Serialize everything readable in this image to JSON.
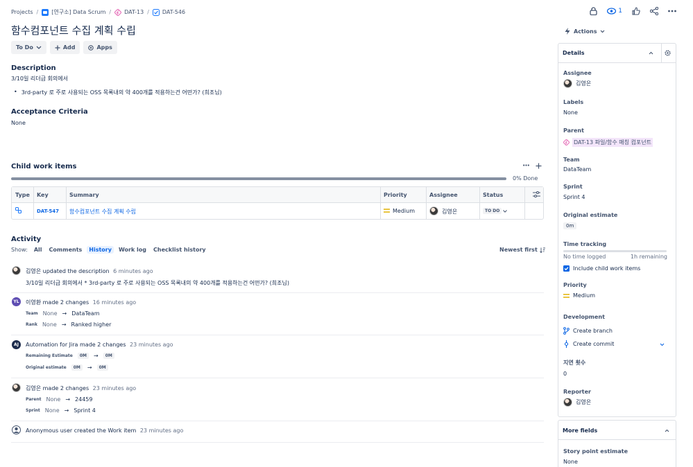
{
  "breadcrumb": {
    "projects": "Projects",
    "project": "[연구소] Data Scrum",
    "parent": "DAT-13",
    "current": "DAT-546"
  },
  "top": {
    "watch_count": "1"
  },
  "issue": {
    "title": "함수컴포넌트 수집 계획 수립",
    "status_button": "To Do",
    "add_button": "Add",
    "apps_button": "Apps"
  },
  "description": {
    "heading": "Description",
    "line1": "3/10일 리더급 회의에서",
    "bullet1": "3rd-party 로 주로 사용되는 OSS 목록내의 약 400개를 적용하는건 어떤가? (희조님)"
  },
  "acceptance": {
    "heading": "Acceptance Criteria",
    "value": "None"
  },
  "child": {
    "heading": "Child work items",
    "progress_text": "0% Done",
    "columns": [
      "Type",
      "Key",
      "Summary",
      "Priority",
      "Assignee",
      "Status"
    ],
    "rows": [
      {
        "key": "DAT-547",
        "summary": "함수컴포넌트 수집 계획 수립",
        "priority": "Medium",
        "assignee": "김영은",
        "status": "TO DO"
      }
    ]
  },
  "activity": {
    "heading": "Activity",
    "show_label": "Show:",
    "tabs": [
      "All",
      "Comments",
      "History",
      "Work log",
      "Checklist history"
    ],
    "active_tab": "History",
    "sort": "Newest first",
    "entries": [
      {
        "actor": "김영은",
        "verb": "updated the",
        "object": "description",
        "time": "6 minutes ago",
        "detail": "3/10일 리더급 회의에서 * 3rd-party 로 주로 사용되는 OSS 목록내의 약 400개를 적용하는건 어떤가? (희조님)"
      },
      {
        "actor": "이영환",
        "verb": "made 2 changes",
        "time": "16 minutes ago",
        "changes": [
          {
            "field": "Team",
            "from": "None",
            "to": "DataTeam"
          },
          {
            "field": "Rank",
            "from": "None",
            "to": "Ranked higher"
          }
        ]
      },
      {
        "actor": "Automation for Jira",
        "verb": "made 2 changes",
        "time": "23 minutes ago",
        "changes": [
          {
            "field": "Remaining Estimate",
            "from": "0M",
            "to": "0M"
          },
          {
            "field": "Original estimate",
            "from": "0M",
            "to": "0M"
          }
        ]
      },
      {
        "actor": "김영은",
        "verb": "made 2 changes",
        "time": "23 minutes ago",
        "changes": [
          {
            "field": "Parent",
            "from": "None",
            "to": "24459"
          },
          {
            "field": "Sprint",
            "from": "None",
            "to": "Sprint 4"
          }
        ]
      },
      {
        "actor": "Anonymous user",
        "verb": "created the",
        "object": "Work item",
        "time": "23 minutes ago"
      }
    ]
  },
  "sidebar": {
    "actions": "Actions",
    "details": "Details",
    "assignee_label": "Assignee",
    "assignee": "김영은",
    "labels_label": "Labels",
    "labels": "None",
    "parent_label": "Parent",
    "parent": "DAT-13 파일/함수 매칭 컴포넌트",
    "team_label": "Team",
    "team": "DataTeam",
    "sprint_label": "Sprint",
    "sprint": "Sprint 4",
    "orig_label": "Original estimate",
    "orig": "0m",
    "tt_label": "Time tracking",
    "tt_logged": "No time logged",
    "tt_remaining": "1h remaining",
    "include_child": "Include child work items",
    "priority_label": "Priority",
    "priority": "Medium",
    "dev_label": "Development",
    "create_branch": "Create branch",
    "create_commit": "Create commit",
    "delay_label": "지연 횟수",
    "delay": "0",
    "reporter_label": "Reporter",
    "reporter": "김영은",
    "more_fields": "More fields",
    "spe_label": "Story point estimate",
    "spe": "None"
  },
  "colors": {
    "accent": "#0c66e4",
    "epic": "#e774bb",
    "medium": "#e2b203"
  }
}
